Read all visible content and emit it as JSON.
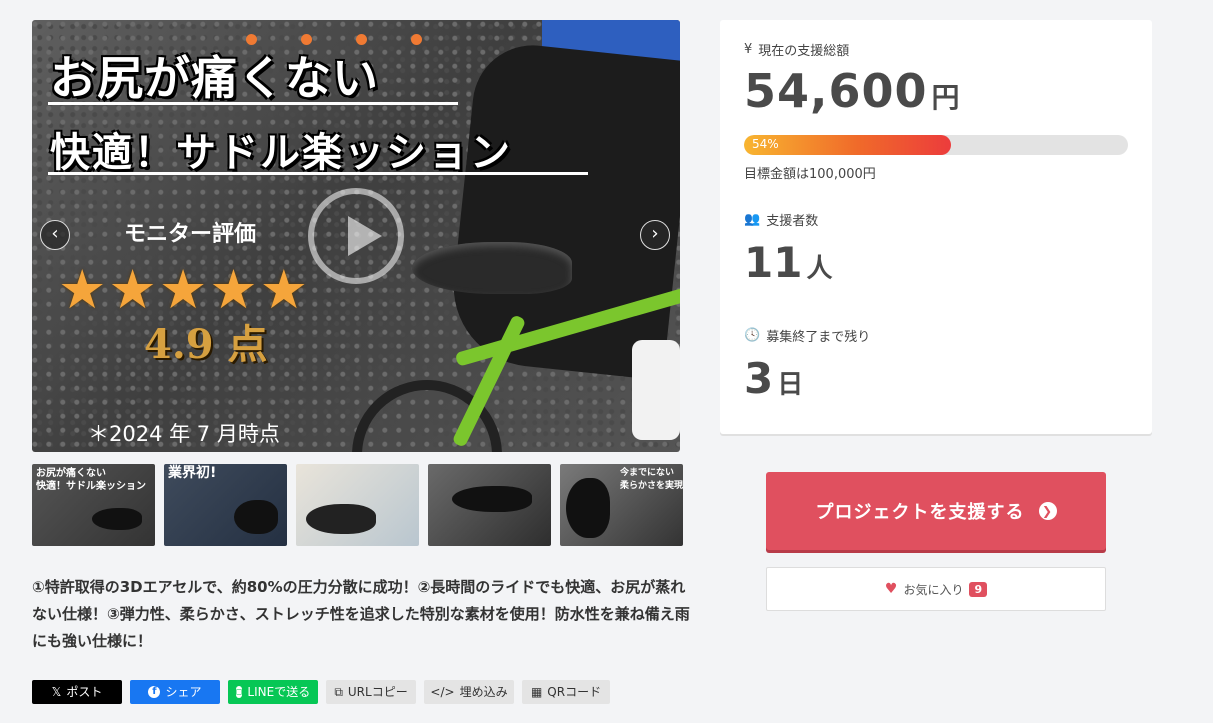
{
  "hero": {
    "title_line1": "お尻が痛くない",
    "title_line2": "快適！サドル楽ッション",
    "monitor_label": "モニター評価",
    "stars": "★★★★★",
    "rating_text": "4.9 点",
    "date_note": "＊2024 年 7 月時点",
    "prev_icon": "chevron-left-icon",
    "next_icon": "chevron-right-icon",
    "play_icon": "play-icon"
  },
  "thumbnails": [
    {
      "caption": "お尻が痛くない\n快適！サドル楽ッション"
    },
    {
      "caption": "業界初!"
    },
    {
      "caption": ""
    },
    {
      "caption": ""
    },
    {
      "caption": "今までにない\n柔らかさを実現"
    }
  ],
  "description": "①特許取得の3Dエアセルで、約80%の圧力分散に成功！②長時間のライドでも快適、お尻が蒸れない仕様！③弾力性、柔らかさ、ストレッチ性を追求した特別な素材を使用！防水性を兼ね備え雨にも強い仕様に！",
  "share": {
    "x": "ポスト",
    "facebook": "シェア",
    "line": "LINEで送る",
    "url": "URLコピー",
    "embed": "埋め込み",
    "qr": "QRコード"
  },
  "stats": {
    "total_label": "現在の支援総額",
    "total_amount": "54,600",
    "total_unit": "円",
    "progress_percent": 54,
    "progress_label": "54%",
    "goal_text": "目標金額は100,000円",
    "supporters_label": "支援者数",
    "supporters_value": "11",
    "supporters_unit": "人",
    "remaining_label": "募集終了まで残り",
    "remaining_value": "3",
    "remaining_unit": "日"
  },
  "cta": {
    "label": "プロジェクトを支援する"
  },
  "favorite": {
    "label": "お気に入り",
    "count": "9"
  },
  "colors": {
    "accent": "#e0505f",
    "progress_start": "#f8b530",
    "progress_end": "#ec3c3c"
  }
}
